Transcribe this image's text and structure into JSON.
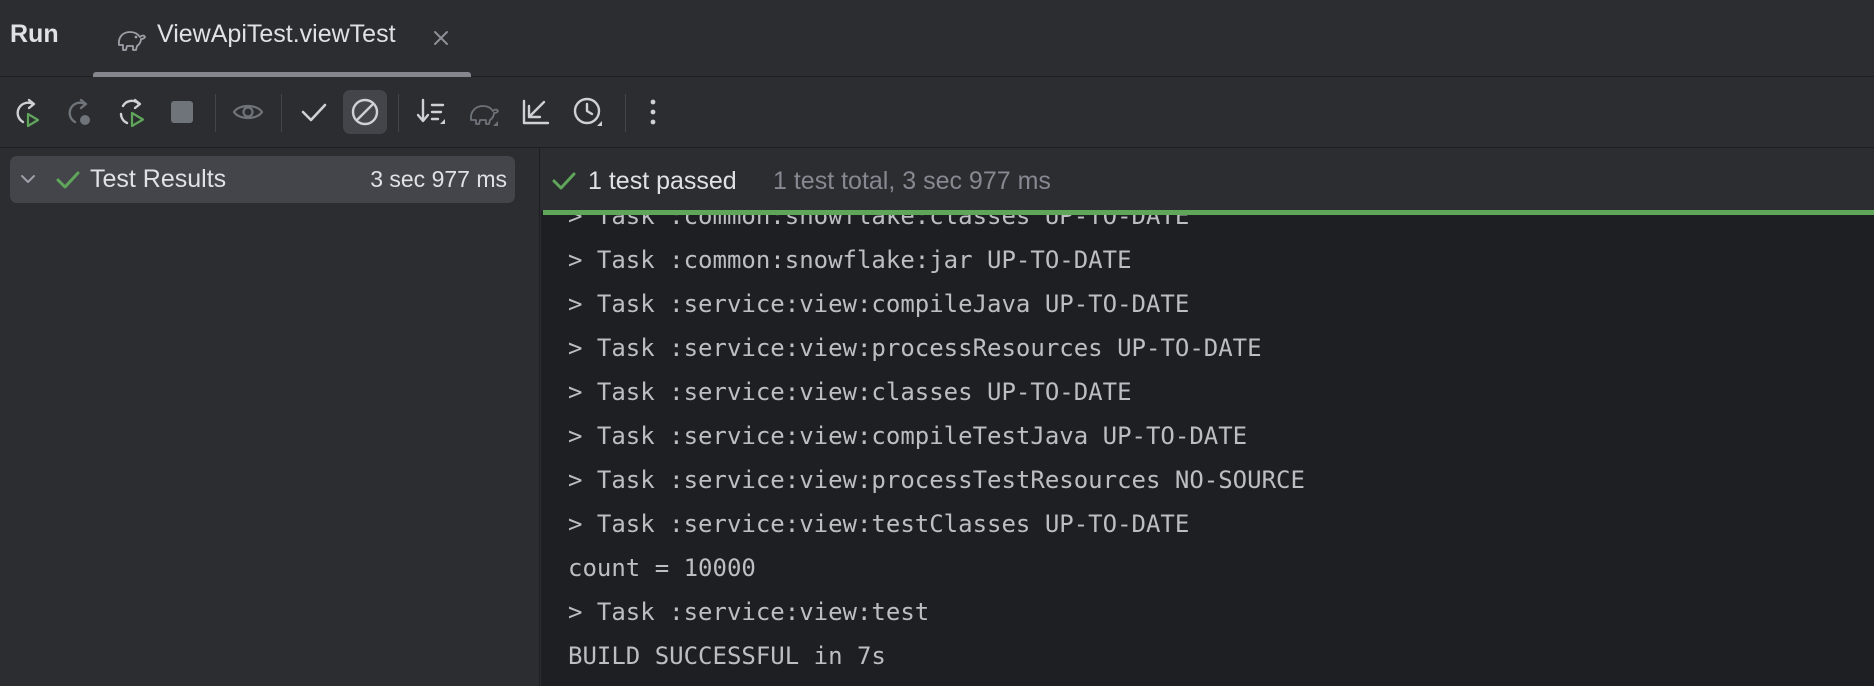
{
  "header": {
    "run_label": "Run",
    "tab": {
      "label": "ViewApiTest.viewTest",
      "icon": "gradle-elephant-icon"
    }
  },
  "toolbar": {
    "buttons": [
      {
        "name": "rerun-button",
        "icon": "rerun-icon"
      },
      {
        "name": "rerun-failed-button",
        "icon": "rerun-failed-icon",
        "disabled": true
      },
      {
        "name": "toggle-auto-test-button",
        "icon": "rerun-automatically-icon"
      },
      {
        "name": "stop-button",
        "icon": "stop-icon",
        "disabled": true
      },
      {
        "name": "show-passed-button",
        "icon": "eye-icon",
        "disabled": true
      },
      {
        "name": "show-passed-check-button",
        "icon": "check-icon"
      },
      {
        "name": "show-ignored-button",
        "icon": "circle-slash-icon",
        "active": true
      },
      {
        "name": "sort-button",
        "icon": "sort-icon"
      },
      {
        "name": "gradle-button",
        "icon": "gradle-icon",
        "disabled": true
      },
      {
        "name": "import-tests-button",
        "icon": "arrow-down-left-icon"
      },
      {
        "name": "test-history-button",
        "icon": "history-clock-icon"
      },
      {
        "name": "more-options-button",
        "icon": "more-vertical-icon"
      }
    ]
  },
  "tree": {
    "root_label": "Test Results",
    "root_time": "3 sec 977 ms"
  },
  "status": {
    "passed": "1 test passed",
    "detail": "1 test total, 3 sec 977 ms"
  },
  "console": {
    "lines": [
      "> Task :common:snowflake:classes UP-TO-DATE",
      "> Task :common:snowflake:jar UP-TO-DATE",
      "> Task :service:view:compileJava UP-TO-DATE",
      "> Task :service:view:processResources UP-TO-DATE",
      "> Task :service:view:classes UP-TO-DATE",
      "> Task :service:view:compileTestJava UP-TO-DATE",
      "> Task :service:view:processTestResources NO-SOURCE",
      "> Task :service:view:testClasses UP-TO-DATE",
      "count = 10000",
      "> Task :service:view:test",
      "BUILD SUCCESSFUL in 7s"
    ]
  },
  "colors": {
    "background": "#2b2d30",
    "console_background": "#1e1f22",
    "success_green": "#5fa65a",
    "text": "#dfe1e5",
    "muted_text": "#868991"
  }
}
